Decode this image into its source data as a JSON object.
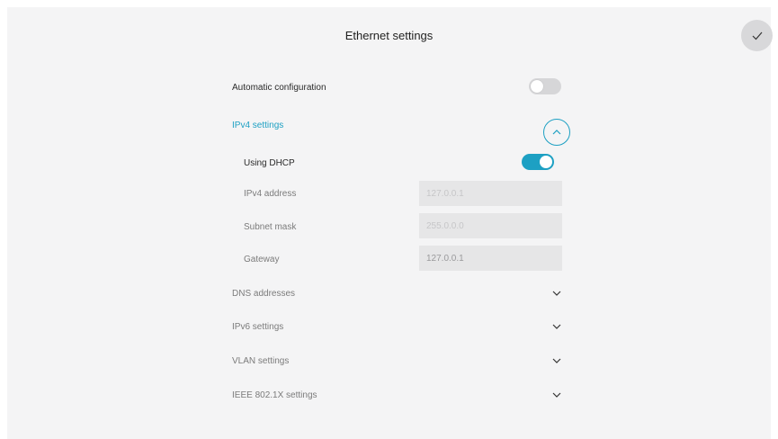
{
  "header": {
    "title": "Ethernet settings"
  },
  "automatic_configuration": {
    "label": "Automatic configuration",
    "enabled": false
  },
  "ipv4": {
    "label": "IPv4 settings",
    "expanded": true,
    "using_dhcp": {
      "label": "Using DHCP",
      "enabled": true
    },
    "fields": [
      {
        "label": "IPv4 address",
        "value": "127.0.0.1"
      },
      {
        "label": "Subnet mask",
        "value": "255.0.0.0"
      },
      {
        "label": "Gateway",
        "value": "127.0.0.1"
      }
    ]
  },
  "sections": [
    {
      "label": "DNS addresses"
    },
    {
      "label": "IPv6 settings"
    },
    {
      "label": "VLAN settings"
    },
    {
      "label": "IEEE 802.1X settings"
    }
  ],
  "colors": {
    "accent": "#1da0c3",
    "background": "#f4f4f5",
    "field": "#e6e6e7"
  },
  "icons": {
    "done": "checkmark-icon",
    "collapse": "chevron-up-icon",
    "expand": "chevron-down-icon"
  }
}
